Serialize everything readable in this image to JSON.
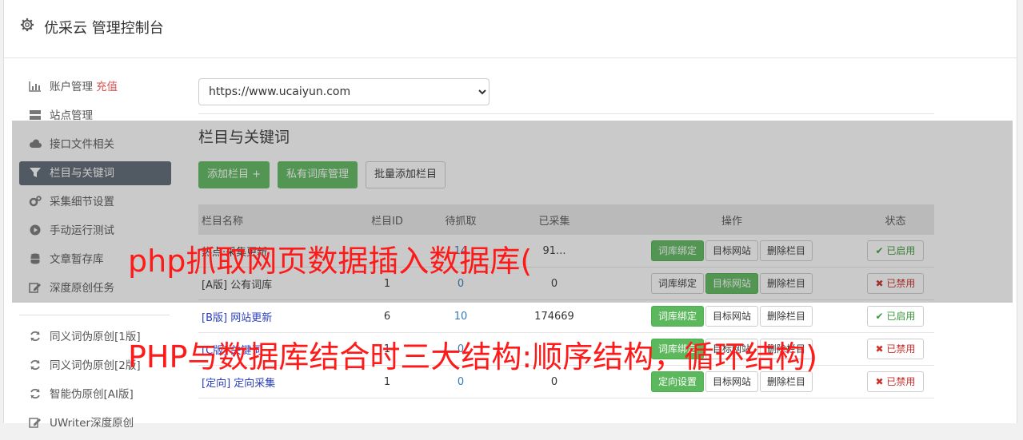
{
  "header": {
    "title": "优采云 管理控制台"
  },
  "sidebar": {
    "items": [
      {
        "label": "账户管理",
        "extra": "充值",
        "icon": "bar-chart-icon"
      },
      {
        "label": "站点管理",
        "icon": "server-icon"
      },
      {
        "label": "接口文件相关",
        "icon": "cloud-icon"
      },
      {
        "label": "栏目与关键词",
        "icon": "filter-icon",
        "active": true
      },
      {
        "label": "采集细节设置",
        "icon": "cogs-icon"
      },
      {
        "label": "手动运行测试",
        "icon": "play-circle-icon"
      },
      {
        "label": "文章暂存库",
        "icon": "database-icon"
      },
      {
        "label": "深度原创任务",
        "icon": "edit-icon"
      }
    ],
    "items2": [
      {
        "label": "同义词伪原创[1版]",
        "icon": "refresh-icon"
      },
      {
        "label": "同义词伪原创[2版]",
        "icon": "refresh-icon"
      },
      {
        "label": "智能伪原创[AI版]",
        "icon": "refresh-icon"
      },
      {
        "label": "UWriter深度原创",
        "icon": "edit-icon"
      }
    ]
  },
  "site_select": {
    "value": "https://www.ucaiyun.com"
  },
  "section_title": "栏目与关键词",
  "buttons": {
    "add_column": "添加栏目 +",
    "private_lexicon": "私有词库管理",
    "batch_add": "批量添加栏目"
  },
  "table": {
    "headers": [
      "栏目名称",
      "栏目ID",
      "待抓取",
      "已采集",
      "操作",
      "状态"
    ],
    "rows": [
      {
        "name": "热点·采集更新",
        "id": "",
        "pending": "14",
        "collected": "91...",
        "ops": [
          "词库绑定",
          "目标网站",
          "删除栏目"
        ],
        "status": "已启用"
      },
      {
        "name": "[A版] 公有词库",
        "id": "1",
        "pending": "0",
        "collected": "0",
        "ops": [
          "词库绑定",
          "目标网站",
          "删除栏目"
        ],
        "status": "已禁用"
      },
      {
        "name": "[B版] 网站更新",
        "id": "6",
        "pending": "10",
        "collected": "174669",
        "ops": [
          "词库绑定",
          "目标网站",
          "删除栏目"
        ],
        "status": "已启用"
      },
      {
        "name": "[C版] 关键词",
        "id": "1",
        "pending": "0",
        "collected": "",
        "ops": [
          "词库绑定",
          "目标网站",
          "删除栏目"
        ],
        "status": "已禁用"
      },
      {
        "name": "[定向] 定向采集",
        "id": "1",
        "pending": "0",
        "collected": "0",
        "ops": [
          "定向设置",
          "目标网站",
          "删除栏目"
        ],
        "status": "已禁用"
      }
    ]
  },
  "watermark": {
    "line1": "php抓取网页数据插入数据库(",
    "line2": "PHP与数据库结合时三大结构:顺序结构，循环结构)"
  },
  "colors": {
    "green": "#5cb85c",
    "active_nav": "#5a6472",
    "watermark": "#ff1a1a"
  }
}
